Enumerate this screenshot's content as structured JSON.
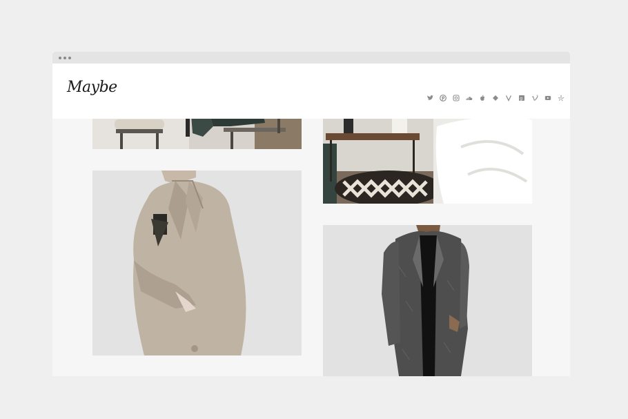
{
  "site": {
    "logo_text": "Maybe"
  },
  "header": {
    "social_icons": [
      "twitter-icon",
      "pinterest-icon",
      "instagram-icon",
      "soundcloud-icon",
      "apple-icon",
      "dribbble-icon",
      "vine-icon",
      "google-plus-icon",
      "vimeo-icon",
      "youtube-icon",
      "yelp-icon"
    ]
  },
  "photos": [
    {
      "subject": "chairs"
    },
    {
      "subject": "bedroom-nightstand"
    },
    {
      "subject": "beige-wool-coat"
    },
    {
      "subject": "grey-tweed-coat"
    }
  ],
  "colors": {
    "background": "#efefef",
    "page": "#f6f6f6",
    "header": "#ffffff",
    "icon": "#8c8c8c"
  }
}
